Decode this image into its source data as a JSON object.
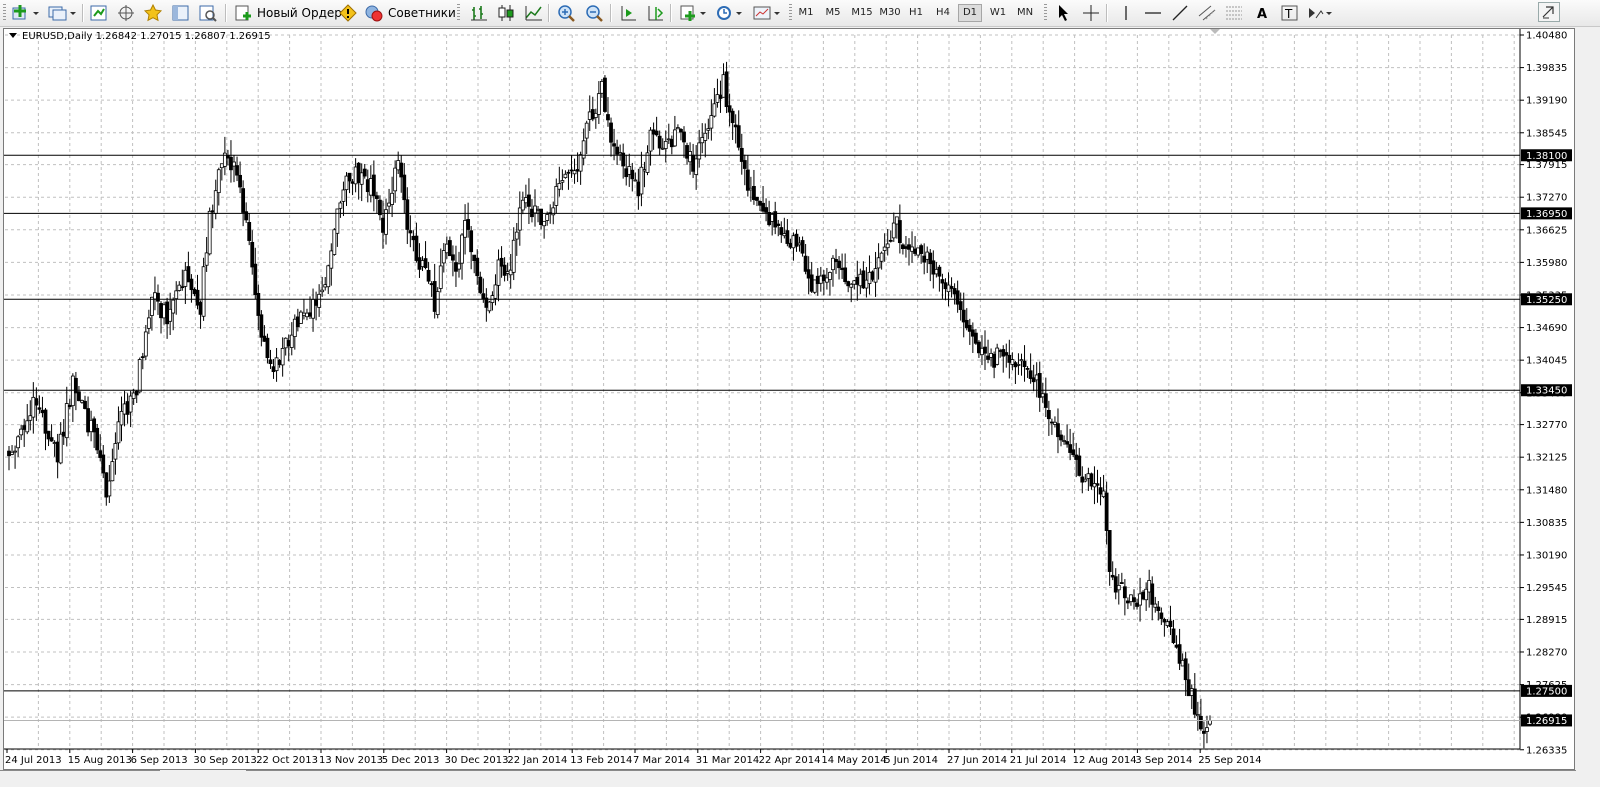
{
  "toolbar": {
    "new_order_label": "Новый Ордер",
    "advisors_label": "Советники",
    "timeframes": [
      "M1",
      "M5",
      "M15",
      "M30",
      "H1",
      "H4",
      "D1",
      "W1",
      "MN"
    ],
    "active_timeframe": "D1",
    "icons": [
      "new-chart-icon",
      "profiles-icon",
      "market-watch-icon",
      "crosshair-move-icon",
      "favorites-icon",
      "navigator-icon",
      "tester-icon",
      "new-order-icon",
      "warning-icon",
      "experts-icon",
      "bar-chart-icon",
      "candlestick-icon",
      "line-chart-icon",
      "zoom-in-icon",
      "zoom-out-icon",
      "autoscroll-icon",
      "chart-shift-icon",
      "indicators-icon",
      "periods-clock-icon",
      "templates-icon",
      "cursor-icon",
      "crosshair-icon",
      "vertical-line-icon",
      "horizontal-line-icon",
      "trendline-icon",
      "equidistant-channel-icon",
      "fibonacci-icon",
      "text-icon",
      "text-label-icon",
      "arrows-icon"
    ]
  },
  "chart": {
    "symbol_label": "EURUSD,Daily  1.26842 1.27015 1.26807 1.26915",
    "colors": {
      "background": "#ffffff",
      "grid": "#c0c0c0",
      "candle": "#000000",
      "label_bg": "#000000",
      "label_text": "#ffffff"
    }
  },
  "chart_data": {
    "type": "candlestick",
    "title": "",
    "symbol": "EURUSD",
    "timeframe": "Daily",
    "last_bar": {
      "open": 1.26842,
      "high": 1.27015,
      "low": 1.26807,
      "close": 1.26915
    },
    "ylim": [
      1.2635,
      1.4048
    ],
    "y_ticks": [
      "1.40480",
      "1.39835",
      "1.39190",
      "1.38545",
      "1.37915",
      "1.37270",
      "1.36625",
      "1.35980",
      "1.35335",
      "1.34690",
      "1.34045",
      "1.33400",
      "1.32770",
      "1.32125",
      "1.31480",
      "1.30835",
      "1.30190",
      "1.29545",
      "1.28915",
      "1.28270",
      "1.27625",
      "1.26980",
      "1.26335"
    ],
    "x_ticks": [
      "24 Jul 2013",
      "15 Aug 2013",
      "6 Sep 2013",
      "30 Sep 2013",
      "22 Oct 2013",
      "13 Nov 2013",
      "5 Dec 2013",
      "30 Dec 2013",
      "22 Jan 2014",
      "13 Feb 2014",
      "7 Mar 2014",
      "31 Mar 2014",
      "22 Apr 2014",
      "14 May 2014",
      "5 Jun 2014",
      "27 Jun 2014",
      "21 Jul 2014",
      "12 Aug 2014",
      "3 Sep 2014",
      "25 Sep 2014"
    ],
    "horizontal_levels": [
      {
        "value": 1.381,
        "label": "1.38100"
      },
      {
        "value": 1.3695,
        "label": "1.36950"
      },
      {
        "value": 1.3525,
        "label": "1.35250"
      },
      {
        "value": 1.3345,
        "label": "1.33450"
      },
      {
        "value": 1.275,
        "label": "1.27500"
      }
    ],
    "bid_level": {
      "value": 1.26915,
      "label": "1.26915"
    },
    "price_path": [
      [
        0,
        1.322
      ],
      [
        9,
        1.333
      ],
      [
        16,
        1.321
      ],
      [
        21,
        1.336
      ],
      [
        28,
        1.325
      ],
      [
        32,
        1.314
      ],
      [
        36,
        1.328
      ],
      [
        42,
        1.335
      ],
      [
        47,
        1.353
      ],
      [
        52,
        1.349
      ],
      [
        58,
        1.358
      ],
      [
        63,
        1.351
      ],
      [
        66,
        1.369
      ],
      [
        71,
        1.381
      ],
      [
        76,
        1.376
      ],
      [
        80,
        1.358
      ],
      [
        83,
        1.346
      ],
      [
        87,
        1.338
      ],
      [
        91,
        1.344
      ],
      [
        95,
        1.349
      ],
      [
        99,
        1.351
      ],
      [
        104,
        1.354
      ],
      [
        108,
        1.372
      ],
      [
        114,
        1.378
      ],
      [
        119,
        1.375
      ],
      [
        123,
        1.366
      ],
      [
        128,
        1.381
      ],
      [
        132,
        1.364
      ],
      [
        137,
        1.358
      ],
      [
        140,
        1.352
      ],
      [
        144,
        1.363
      ],
      [
        147,
        1.357
      ],
      [
        150,
        1.369
      ],
      [
        154,
        1.357
      ],
      [
        157,
        1.35
      ],
      [
        161,
        1.359
      ],
      [
        164,
        1.356
      ],
      [
        169,
        1.372
      ],
      [
        176,
        1.367
      ],
      [
        181,
        1.375
      ],
      [
        186,
        1.377
      ],
      [
        190,
        1.387
      ],
      [
        195,
        1.394
      ],
      [
        199,
        1.382
      ],
      [
        203,
        1.378
      ],
      [
        207,
        1.374
      ],
      [
        211,
        1.386
      ],
      [
        215,
        1.381
      ],
      [
        220,
        1.385
      ],
      [
        225,
        1.379
      ],
      [
        230,
        1.388
      ],
      [
        235,
        1.395
      ],
      [
        240,
        1.383
      ],
      [
        245,
        1.371
      ],
      [
        250,
        1.369
      ],
      [
        255,
        1.364
      ],
      [
        260,
        1.363
      ],
      [
        264,
        1.355
      ],
      [
        268,
        1.358
      ],
      [
        272,
        1.36
      ],
      [
        276,
        1.354
      ],
      [
        280,
        1.356
      ],
      [
        284,
        1.358
      ],
      [
        288,
        1.362
      ],
      [
        292,
        1.367
      ],
      [
        296,
        1.361
      ],
      [
        300,
        1.363
      ],
      [
        304,
        1.357
      ],
      [
        308,
        1.356
      ],
      [
        311,
        1.354
      ],
      [
        314,
        1.35
      ],
      [
        318,
        1.344
      ],
      [
        322,
        1.34
      ],
      [
        326,
        1.342
      ],
      [
        330,
        1.339
      ],
      [
        334,
        1.339
      ],
      [
        338,
        1.336
      ],
      [
        341,
        1.33
      ],
      [
        344,
        1.327
      ],
      [
        348,
        1.323
      ],
      [
        352,
        1.319
      ],
      [
        356,
        1.316
      ],
      [
        360,
        1.314
      ],
      [
        362,
        1.299
      ],
      [
        365,
        1.295
      ],
      [
        368,
        1.293
      ],
      [
        371,
        1.292
      ],
      [
        374,
        1.296
      ],
      [
        378,
        1.292
      ],
      [
        382,
        1.286
      ],
      [
        385,
        1.281
      ],
      [
        388,
        1.276
      ],
      [
        391,
        1.27
      ],
      [
        393,
        1.267
      ],
      [
        395,
        1.2692
      ]
    ]
  }
}
